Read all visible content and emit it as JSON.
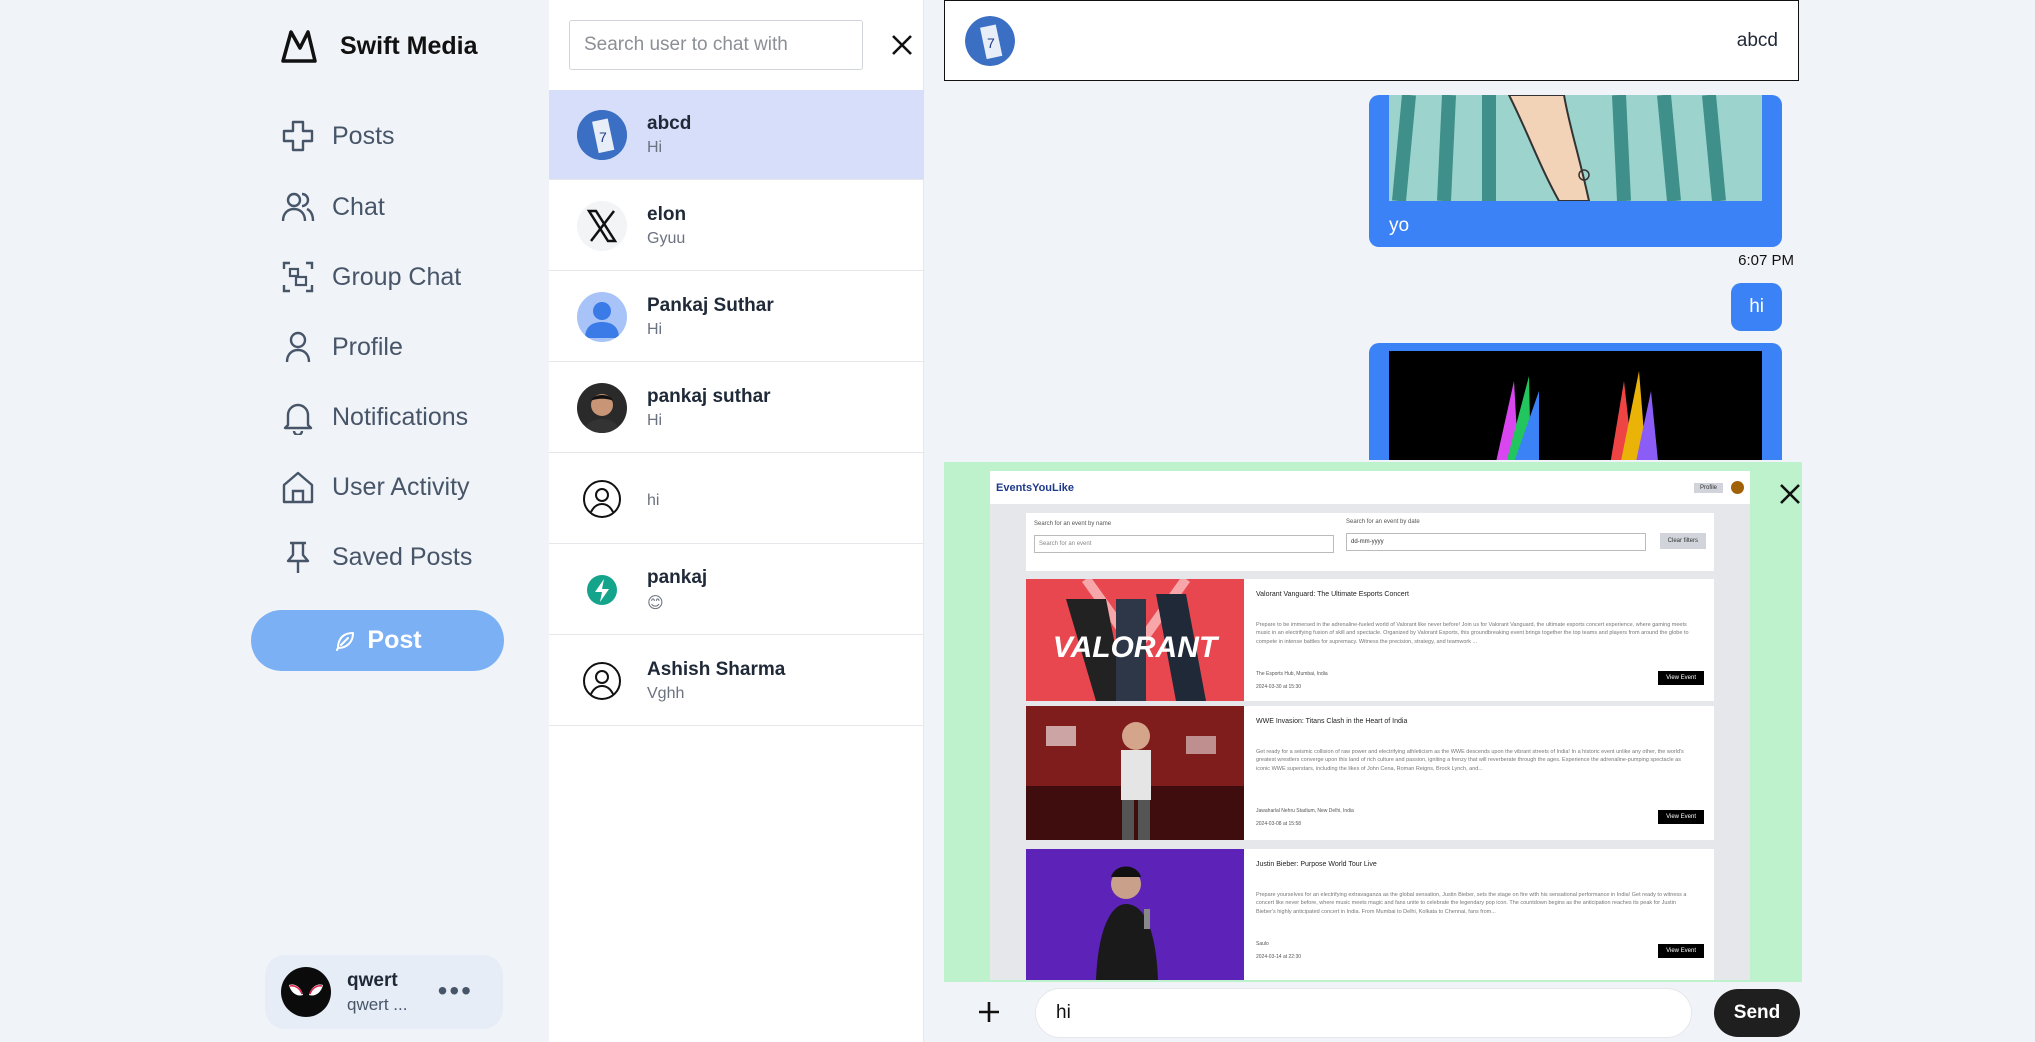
{
  "brand": {
    "name": "Swift Media"
  },
  "nav": [
    {
      "label": "Posts",
      "icon": "plus-cross-icon"
    },
    {
      "label": "Chat",
      "icon": "users-icon"
    },
    {
      "label": "Group Chat",
      "icon": "group-icon"
    },
    {
      "label": "Profile",
      "icon": "user-icon"
    },
    {
      "label": "Notifications",
      "icon": "bell-icon"
    },
    {
      "label": "User Activity",
      "icon": "home-icon"
    },
    {
      "label": "Saved Posts",
      "icon": "pin-icon"
    }
  ],
  "post_button": {
    "label": "Post"
  },
  "current_user": {
    "name": "qwert",
    "handle": "qwert ...",
    "more": "•••"
  },
  "search": {
    "placeholder": "Search user to chat with"
  },
  "chats": [
    {
      "name": "abcd",
      "last": "Hi"
    },
    {
      "name": "elon",
      "last": "Gyuu"
    },
    {
      "name": "Pankaj Suthar",
      "last": "Hi"
    },
    {
      "name": "pankaj suthar",
      "last": "Hi"
    },
    {
      "name": "",
      "last": "hi"
    },
    {
      "name": "pankaj",
      "last": "😊"
    },
    {
      "name": "Ashish Sharma",
      "last": "Vghh"
    }
  ],
  "conversation": {
    "header_name": "abcd",
    "messages": [
      {
        "text": "yo"
      },
      {
        "time": "6:07 PM"
      },
      {
        "text": "hi"
      }
    ]
  },
  "preview": {
    "logo": "EventsYouLike",
    "profile_btn": "Profile",
    "search_name_label": "Search for an event by name",
    "search_name_placeholder": "Search for an event",
    "search_date_label": "Search for an event by date",
    "date_placeholder": "dd-mm-yyyy",
    "clear_filters": "Clear filters",
    "events": [
      {
        "title": "Valorant Vanguard: The Ultimate Esports Concert",
        "image_text": "VALORANT",
        "desc": "Prepare to be immersed in the adrenaline-fueled world of Valorant like never before! Join us for Valorant Vanguard, the ultimate esports concert experience, where gaming meets music in an electrifying fusion of skill and spectacle. Organized by Valorant Esports, this groundbreaking event brings together the top teams and players from around the globe to compete in intense battles for supremacy. Witness the precision, strategy, and teamwork ...",
        "venue": "The Esports Hub, Mumbai, India",
        "date": "2024-03-30 at 15:30",
        "button": "View Event"
      },
      {
        "title": "WWE Invasion: Titans Clash in the Heart of India",
        "image_text": "",
        "desc": "Get ready for a seismic collision of raw power and electrifying athleticism as the WWE descends upon the vibrant streets of India! In a historic event unlike any other, the world's greatest wrestlers converge upon this land of rich culture and passion, igniting a frenzy that will reverberate through the ages. Experience the adrenaline-pumping spectacle as iconic WWE superstars, including the likes of John Cena, Roman Reigns, Brock Lynch, and...",
        "venue": "Jawaharlal Nehru Stadium, New Delhi, India",
        "date": "2024-03-08 at 15:58",
        "button": "View Event"
      },
      {
        "title": "Justin Bieber: Purpose World Tour Live",
        "image_text": "",
        "desc": "Prepare yourselves for an electrifying extravaganza as the global sensation, Justin Bieber, sets the stage on fire with his sensational performance in India! Get ready to witness a concert like never before, where music meets magic and fans unite to celebrate the legendary pop icon. The countdown begins as the anticipation reaches its peak for Justin Bieber's highly anticipated concert in India. From Mumbai to Delhi, Kolkata to Chennai, fans from...",
        "venue": "Saulo",
        "date": "2024-03-14 at 22:30",
        "button": "View Event"
      }
    ]
  },
  "composer": {
    "value": "hi",
    "send": "Send"
  },
  "colors": {
    "accent": "#3b82f6",
    "post_btn": "#7cb0f5",
    "active_chat": "#d6defa",
    "preview_bg": "#bdf2cc"
  }
}
